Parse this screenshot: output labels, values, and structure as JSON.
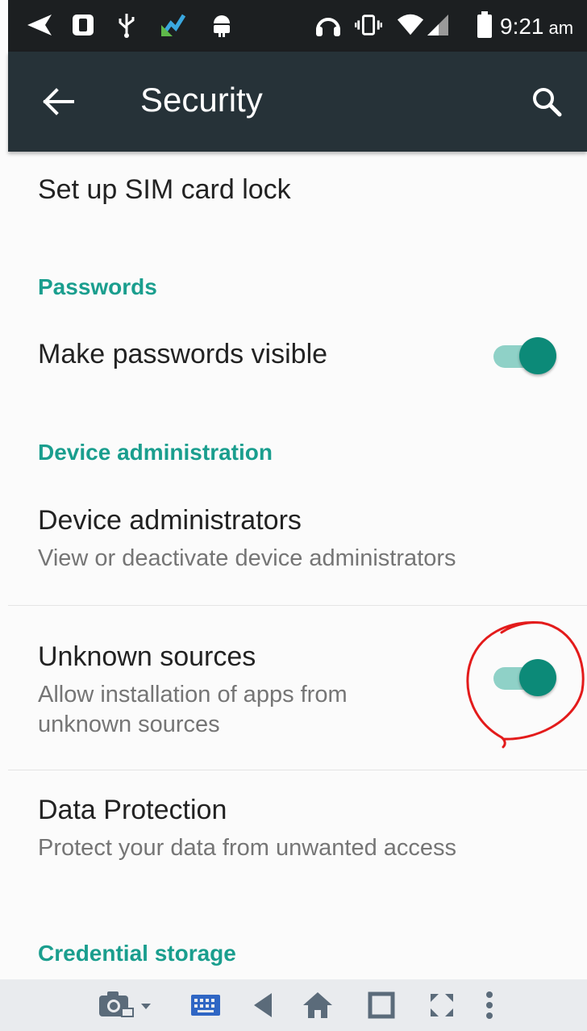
{
  "status_bar": {
    "time": "9:21",
    "ampm": "am",
    "icons": [
      "send-icon",
      "sim-notification-icon",
      "usb-icon",
      "upload-icon",
      "android-icon",
      "headset-icon",
      "vibrate-icon",
      "wifi-icon",
      "signal-icon",
      "battery-icon"
    ]
  },
  "toolbar": {
    "title": "Security",
    "back_icon": "back-arrow-icon",
    "search_icon": "search-icon"
  },
  "sections": {
    "sim_lock": {
      "title": "Set up SIM card lock"
    },
    "passwords": {
      "header": "Passwords",
      "make_visible": {
        "title": "Make passwords visible",
        "enabled": true
      }
    },
    "device_admin": {
      "header": "Device administration",
      "administrators": {
        "title": "Device administrators",
        "summary": "View or deactivate device administrators"
      },
      "unknown_sources": {
        "title": "Unknown sources",
        "summary": "Allow installation of apps from unknown sources",
        "enabled": true
      },
      "data_protection": {
        "title": "Data Protection",
        "summary": "Protect your data from unwanted access"
      }
    },
    "credential_storage": {
      "header": "Credential storage"
    }
  },
  "bottom_nav": {
    "icons": [
      "camera-icon",
      "dropdown-icon",
      "keyboard-icon",
      "nav-back-icon",
      "nav-home-icon",
      "nav-recents-icon",
      "fullscreen-icon",
      "more-vert-icon"
    ]
  },
  "colors": {
    "status_bar": "#1c1f21",
    "toolbar": "#263238",
    "accent": "#1a9e8e",
    "switch_thumb": "#0c8a78",
    "switch_track": "#8fd1c7",
    "annotation": "#e31b1b"
  }
}
